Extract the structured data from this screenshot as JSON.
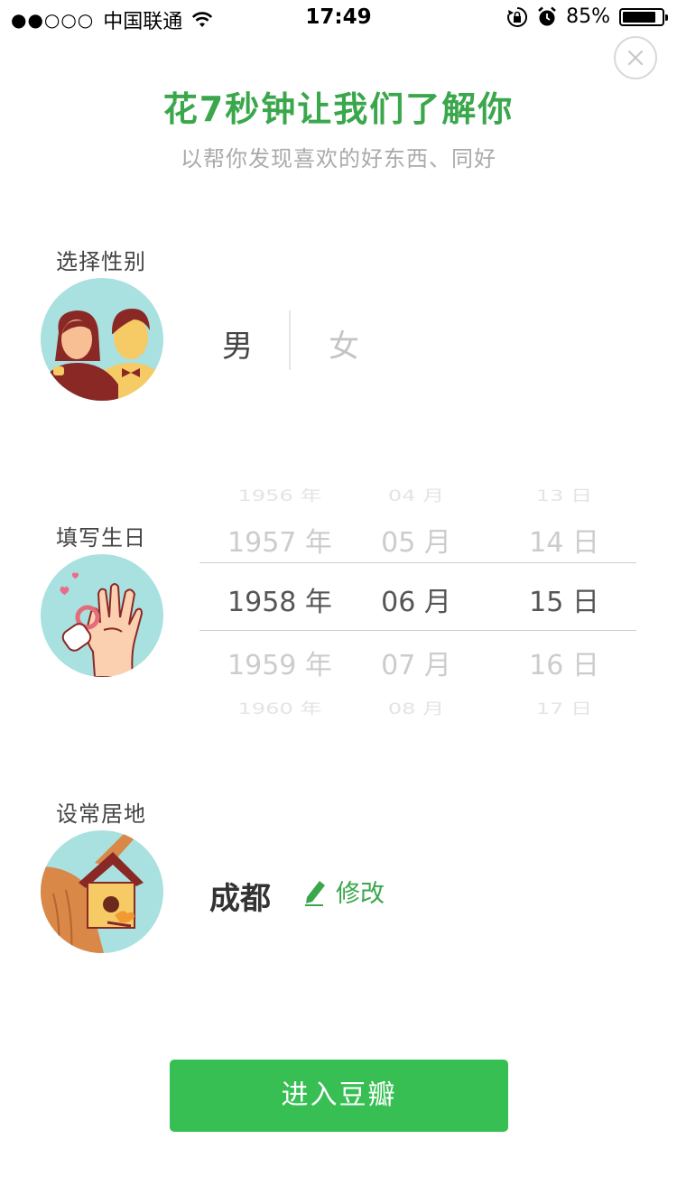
{
  "status_bar": {
    "signal": "●●○○○",
    "carrier": "中国联通",
    "time": "17:49",
    "battery_text": "85%",
    "battery_level": 0.85
  },
  "header": {
    "title": "花7秒钟让我们了解你",
    "subtitle": "以帮你发现喜欢的好东西、同好"
  },
  "gender_section": {
    "label": "选择性别",
    "male": "男",
    "female": "女",
    "selected": "male"
  },
  "birthday_section": {
    "label": "填写生日",
    "years": [
      "1956 年",
      "1957 年",
      "1958 年",
      "1959 年",
      "1960 年"
    ],
    "months": [
      "04 月",
      "05 月",
      "06 月",
      "07 月",
      "08 月"
    ],
    "days": [
      "13 日",
      "14 日",
      "15 日",
      "16 日",
      "17 日"
    ],
    "selected_index": 2
  },
  "location_section": {
    "label": "设常居地",
    "city": "成都",
    "edit_label": "修改"
  },
  "enter_button": "进入豆瓣",
  "colors": {
    "accent_green": "#3aa74c",
    "button_green": "#38bf53",
    "avatar_bg": "#a9e0e0"
  },
  "icons": [
    "wifi-icon",
    "rotation-lock-icon",
    "alarm-icon",
    "battery-icon",
    "close-icon",
    "couple-icon",
    "baby-hand-icon",
    "birdhouse-icon",
    "pencil-icon"
  ]
}
